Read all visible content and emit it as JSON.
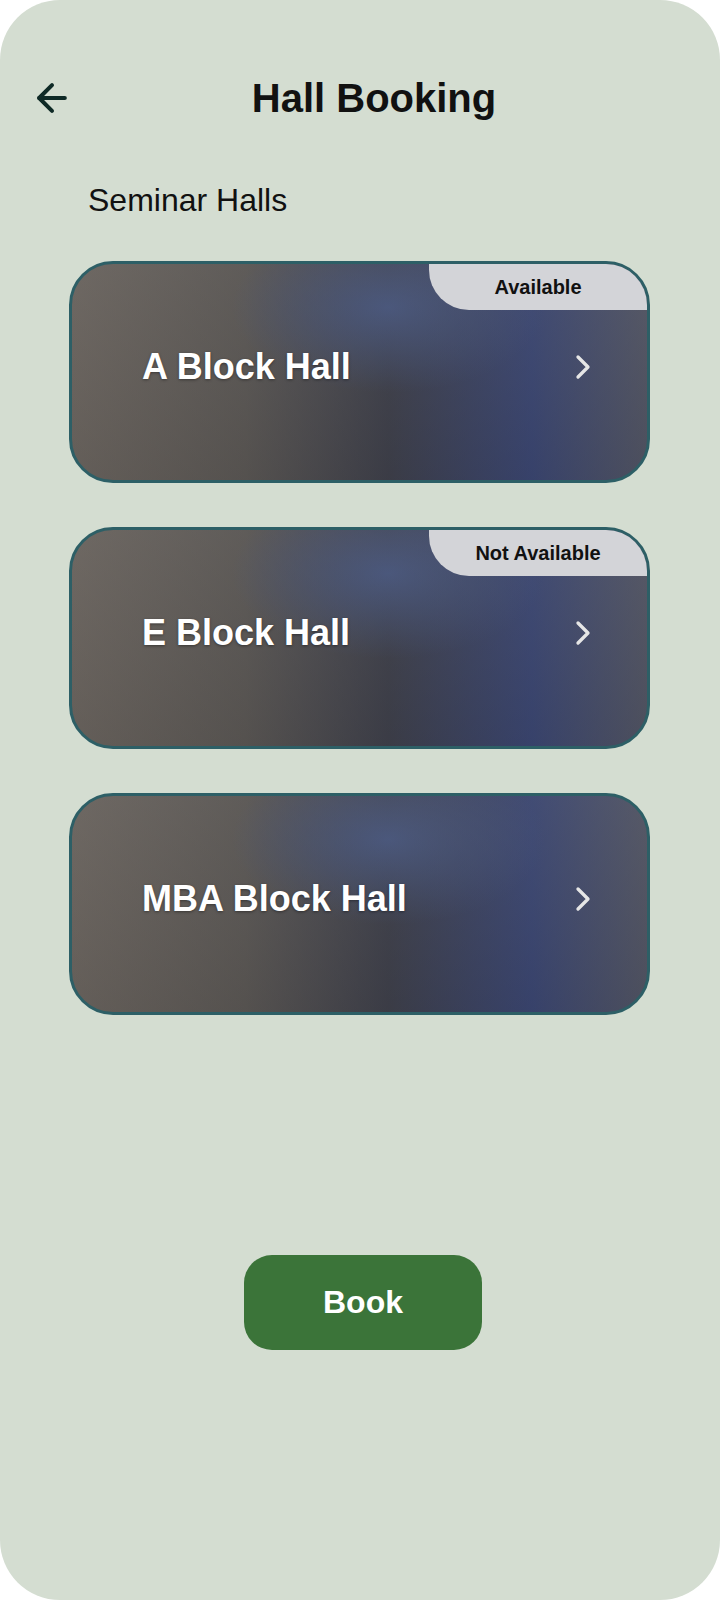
{
  "header": {
    "title": "Hall Booking"
  },
  "section": {
    "title": "Seminar Halls"
  },
  "halls": [
    {
      "name": "A Block Hall",
      "badge": "Available"
    },
    {
      "name": "E Block Hall",
      "badge": "Not Available"
    },
    {
      "name": "MBA Block Hall",
      "badge": null
    }
  ],
  "button": {
    "label": "Book"
  }
}
